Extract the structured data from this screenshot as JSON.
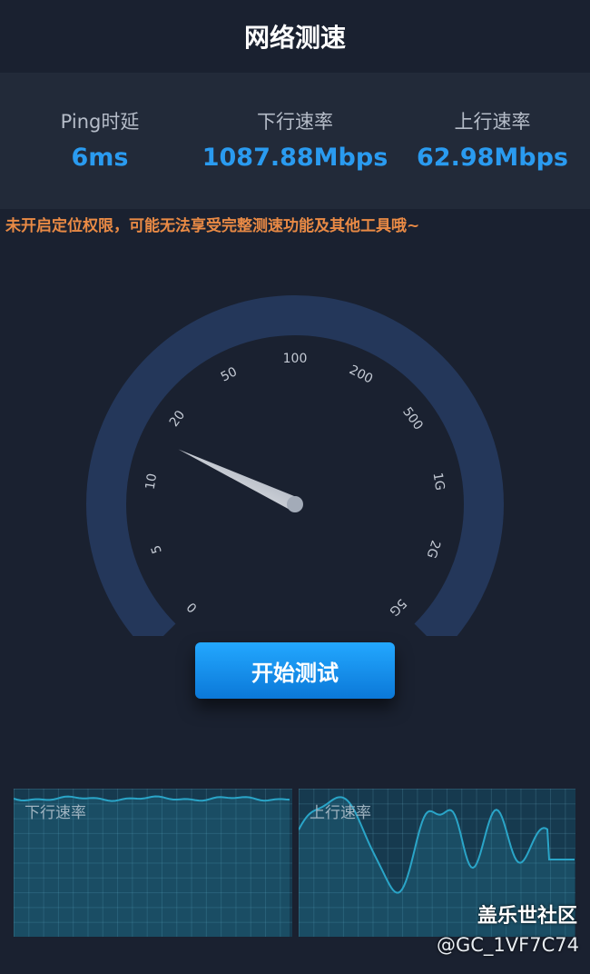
{
  "header": {
    "title": "网络测速"
  },
  "stats": {
    "ping": {
      "label": "Ping时延",
      "value": "6ms"
    },
    "download": {
      "label": "下行速率",
      "value": "1087.88Mbps"
    },
    "upload": {
      "label": "上行速率",
      "value": "62.98Mbps"
    }
  },
  "warning": "未开启定位权限，可能无法享受完整测速功能及其他工具哦~",
  "gauge": {
    "ticks": [
      "0",
      "5",
      "10",
      "20",
      "50",
      "100",
      "200",
      "500",
      "1G",
      "2G",
      "5G"
    ],
    "needle_tick_position": 2.6,
    "colors": {
      "arc": "#24375a",
      "background": "#1a2130"
    }
  },
  "start_button": {
    "label": "开始测试"
  },
  "charts": {
    "download": {
      "label": "下行速率",
      "color": "#2aa5c8"
    },
    "upload": {
      "label": "上行速率",
      "color": "#2aa5c8"
    }
  },
  "watermark": {
    "title": "盖乐世社区",
    "user": "@GC_1VF7C74"
  },
  "colors": {
    "accent": "#2a9bf0",
    "warning": "#e98a45",
    "page_bg": "#1a2130"
  }
}
